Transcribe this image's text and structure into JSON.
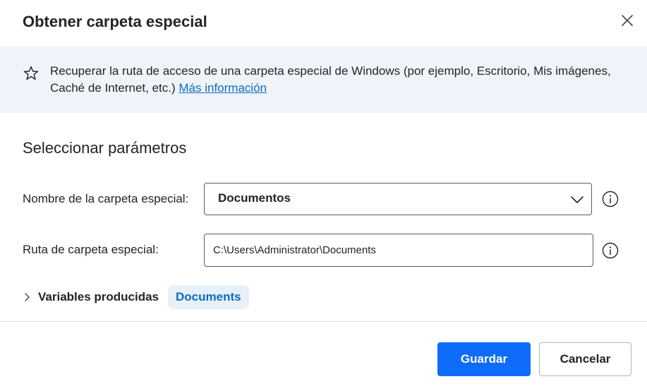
{
  "dialog": {
    "title": "Obtener carpeta especial",
    "close_icon": "close-icon"
  },
  "banner": {
    "icon": "star-outline-icon",
    "text": "Recuperar la ruta de acceso de una carpeta especial de Windows (por ejemplo, Escritorio, Mis imágenes, Caché de Internet, etc.) ",
    "link_text": "Más información",
    "background_color": "#eff4fb",
    "link_color": "#0f6cbd"
  },
  "parameters": {
    "section_title": "Seleccionar parámetros",
    "folder_name": {
      "label": "Nombre de la carpeta especial:",
      "selected_value": "Documentos",
      "icon": "chevron-down-icon",
      "info_icon": "info-icon"
    },
    "folder_path": {
      "label": "Ruta de carpeta especial:",
      "value": "C:\\Users\\Administrator\\Documents",
      "info_icon": "info-icon"
    }
  },
  "variables": {
    "label": "Variables producidas",
    "expand_icon": "chevron-right-icon",
    "chip": "Documents",
    "chip_color": "#0f6cbd"
  },
  "footer": {
    "save_label": "Guardar",
    "cancel_label": "Cancelar",
    "primary_color": "#0f6cfb"
  }
}
